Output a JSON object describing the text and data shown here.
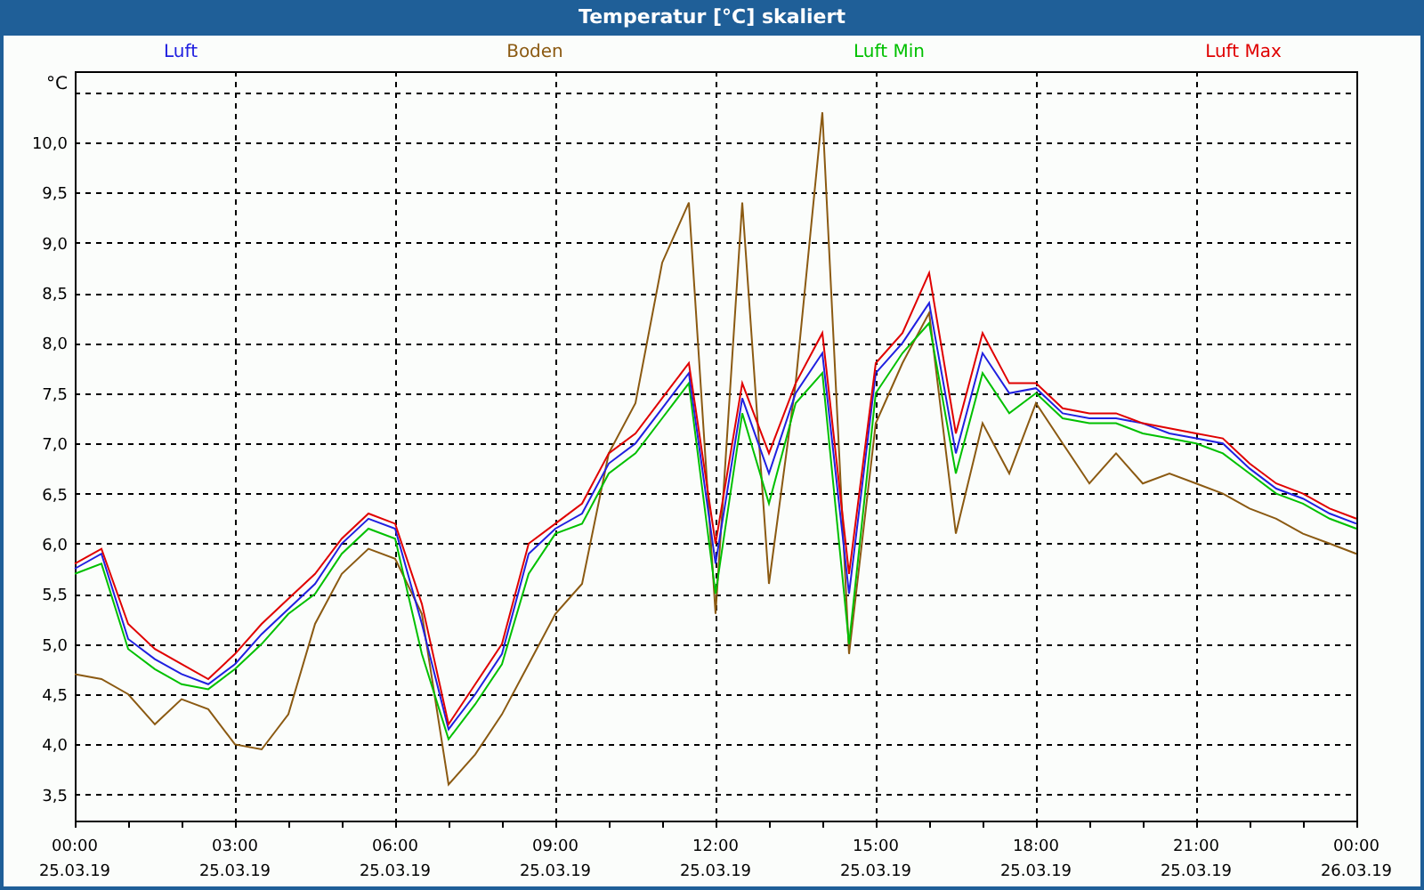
{
  "window": {
    "title": "Temperatur [°C] skaliert"
  },
  "chart": {
    "date_labels": [
      "25.03.19",
      "25.03.19",
      "25.03.19",
      "25.03.19",
      "25.03.19",
      "25.03.19",
      "25.03.19",
      "25.03.19",
      "26.03.19"
    ],
    "chart_data": {
      "type": "line",
      "ylabel": "°C",
      "x": [
        0,
        0.5,
        1,
        1.5,
        2,
        2.5,
        3,
        3.5,
        4,
        4.5,
        5,
        5.5,
        6,
        6.5,
        7,
        7.5,
        8,
        8.5,
        9,
        9.5,
        10,
        10.5,
        11,
        11.5,
        12,
        12.5,
        13,
        13.5,
        14,
        14.5,
        15,
        15.5,
        16,
        16.5,
        17,
        17.5,
        18,
        18.5,
        19,
        19.5,
        20,
        20.5,
        21,
        21.5,
        22,
        22.5,
        23,
        23.5,
        24
      ],
      "series": [
        {
          "name": "Luft",
          "color": "#2020e0",
          "values": [
            5.75,
            5.9,
            5.05,
            4.85,
            4.7,
            4.6,
            4.8,
            5.1,
            5.35,
            5.6,
            6.0,
            6.25,
            6.15,
            5.2,
            4.15,
            4.5,
            4.9,
            5.9,
            6.15,
            6.3,
            6.8,
            7.0,
            7.35,
            7.7,
            5.8,
            7.45,
            6.7,
            7.5,
            7.9,
            5.5,
            7.7,
            8.0,
            8.4,
            6.9,
            7.9,
            7.5,
            7.55,
            7.3,
            7.25,
            7.25,
            7.2,
            7.1,
            7.05,
            7.0,
            6.75,
            6.55,
            6.45,
            6.3,
            6.2
          ]
        },
        {
          "name": "Boden",
          "color": "#8b5a12",
          "values": [
            4.7,
            4.65,
            4.5,
            4.2,
            4.45,
            4.35,
            4.0,
            3.95,
            4.3,
            5.2,
            5.7,
            5.95,
            5.85,
            5.3,
            3.6,
            3.9,
            4.3,
            4.8,
            5.3,
            5.6,
            6.9,
            7.4,
            8.8,
            9.4,
            5.3,
            9.4,
            5.6,
            7.6,
            10.3,
            4.9,
            7.2,
            7.8,
            8.3,
            6.1,
            7.2,
            6.7,
            7.4,
            7.0,
            6.6,
            6.9,
            6.6,
            6.7,
            6.6,
            6.5,
            6.35,
            6.25,
            6.1,
            6.0,
            5.9
          ]
        },
        {
          "name": "Luft Min",
          "color": "#00c000",
          "values": [
            5.7,
            5.8,
            4.95,
            4.75,
            4.6,
            4.55,
            4.75,
            5.0,
            5.3,
            5.5,
            5.9,
            6.15,
            6.05,
            4.9,
            4.05,
            4.4,
            4.8,
            5.7,
            6.1,
            6.2,
            6.7,
            6.9,
            7.25,
            7.6,
            5.5,
            7.3,
            6.4,
            7.4,
            7.7,
            5.0,
            7.5,
            7.9,
            8.2,
            6.7,
            7.7,
            7.3,
            7.5,
            7.25,
            7.2,
            7.2,
            7.1,
            7.05,
            7.0,
            6.9,
            6.7,
            6.5,
            6.4,
            6.25,
            6.15
          ]
        },
        {
          "name": "Luft Max",
          "color": "#e00000",
          "values": [
            5.8,
            5.95,
            5.2,
            4.95,
            4.8,
            4.65,
            4.9,
            5.2,
            5.45,
            5.7,
            6.05,
            6.3,
            6.2,
            5.4,
            4.2,
            4.6,
            5.0,
            6.0,
            6.2,
            6.4,
            6.9,
            7.1,
            7.45,
            7.8,
            6.0,
            7.6,
            6.9,
            7.6,
            8.1,
            5.7,
            7.8,
            8.1,
            8.7,
            7.1,
            8.1,
            7.6,
            7.6,
            7.35,
            7.3,
            7.3,
            7.2,
            7.15,
            7.1,
            7.05,
            6.8,
            6.6,
            6.5,
            6.35,
            6.25
          ]
        }
      ],
      "grid": true,
      "xlim": [
        0,
        24
      ],
      "ylim": [
        3.24,
        10.71
      ],
      "xticks": [
        {
          "value": 0,
          "label": "00:00"
        },
        {
          "value": 3,
          "label": "03:00"
        },
        {
          "value": 6,
          "label": "06:00"
        },
        {
          "value": 9,
          "label": "09:00"
        },
        {
          "value": 12,
          "label": "12:00"
        },
        {
          "value": 15,
          "label": "15:00"
        },
        {
          "value": 18,
          "label": "18:00"
        },
        {
          "value": 21,
          "label": "21:00"
        },
        {
          "value": 24,
          "label": "00:00"
        }
      ],
      "yticks": [
        {
          "value": 3.5,
          "label": "3,5"
        },
        {
          "value": 4,
          "label": "4,0"
        },
        {
          "value": 4.5,
          "label": "4,5"
        },
        {
          "value": 5,
          "label": "5,0"
        },
        {
          "value": 5.5,
          "label": "5,5"
        },
        {
          "value": 6,
          "label": "6,0"
        },
        {
          "value": 6.5,
          "label": "6,5"
        },
        {
          "value": 7,
          "label": "7,0"
        },
        {
          "value": 7.5,
          "label": "7,5"
        },
        {
          "value": 8,
          "label": "8,0"
        },
        {
          "value": 8.5,
          "label": "8,5"
        },
        {
          "value": 9,
          "label": "9,0"
        },
        {
          "value": 9.5,
          "label": "9,5"
        },
        {
          "value": 10,
          "label": "10,0"
        }
      ]
    }
  }
}
